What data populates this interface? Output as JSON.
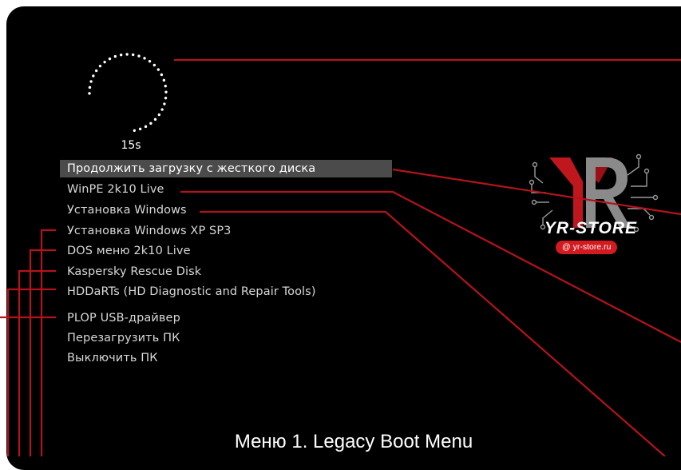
{
  "timer": {
    "label": "15s"
  },
  "menu": {
    "items": [
      {
        "label": "Продолжить загрузку с жесткого диска",
        "selected": true
      },
      {
        "label": "WinPE 2k10 Live",
        "selected": false
      },
      {
        "label": "Установка Windows",
        "selected": false
      },
      {
        "label": "Установка Windows XP SP3",
        "selected": false
      },
      {
        "label": "DOS меню 2k10 Live",
        "selected": false
      },
      {
        "label": "Kaspersky Rescue Disk",
        "selected": false
      },
      {
        "label": "HDDaRTs (HD Diagnostic and Repair Tools)",
        "selected": false
      },
      {
        "label": "PLOP USB-драйвер",
        "selected": false
      },
      {
        "label": "Перезагрузить ПК",
        "selected": false
      },
      {
        "label": "Выключить ПК",
        "selected": false
      }
    ]
  },
  "brand": {
    "logo_letters": "YR",
    "name": "YR-STORE",
    "site": "yr-store.ru",
    "site_icon": "at-sign-icon"
  },
  "caption": "Меню 1. Legacy Boot Menu",
  "colors": {
    "background": "#000000",
    "accent_red": "#c0161d",
    "line_red": "#b3141b",
    "selection": "#4b4b4b",
    "text": "#d8d8d8"
  }
}
